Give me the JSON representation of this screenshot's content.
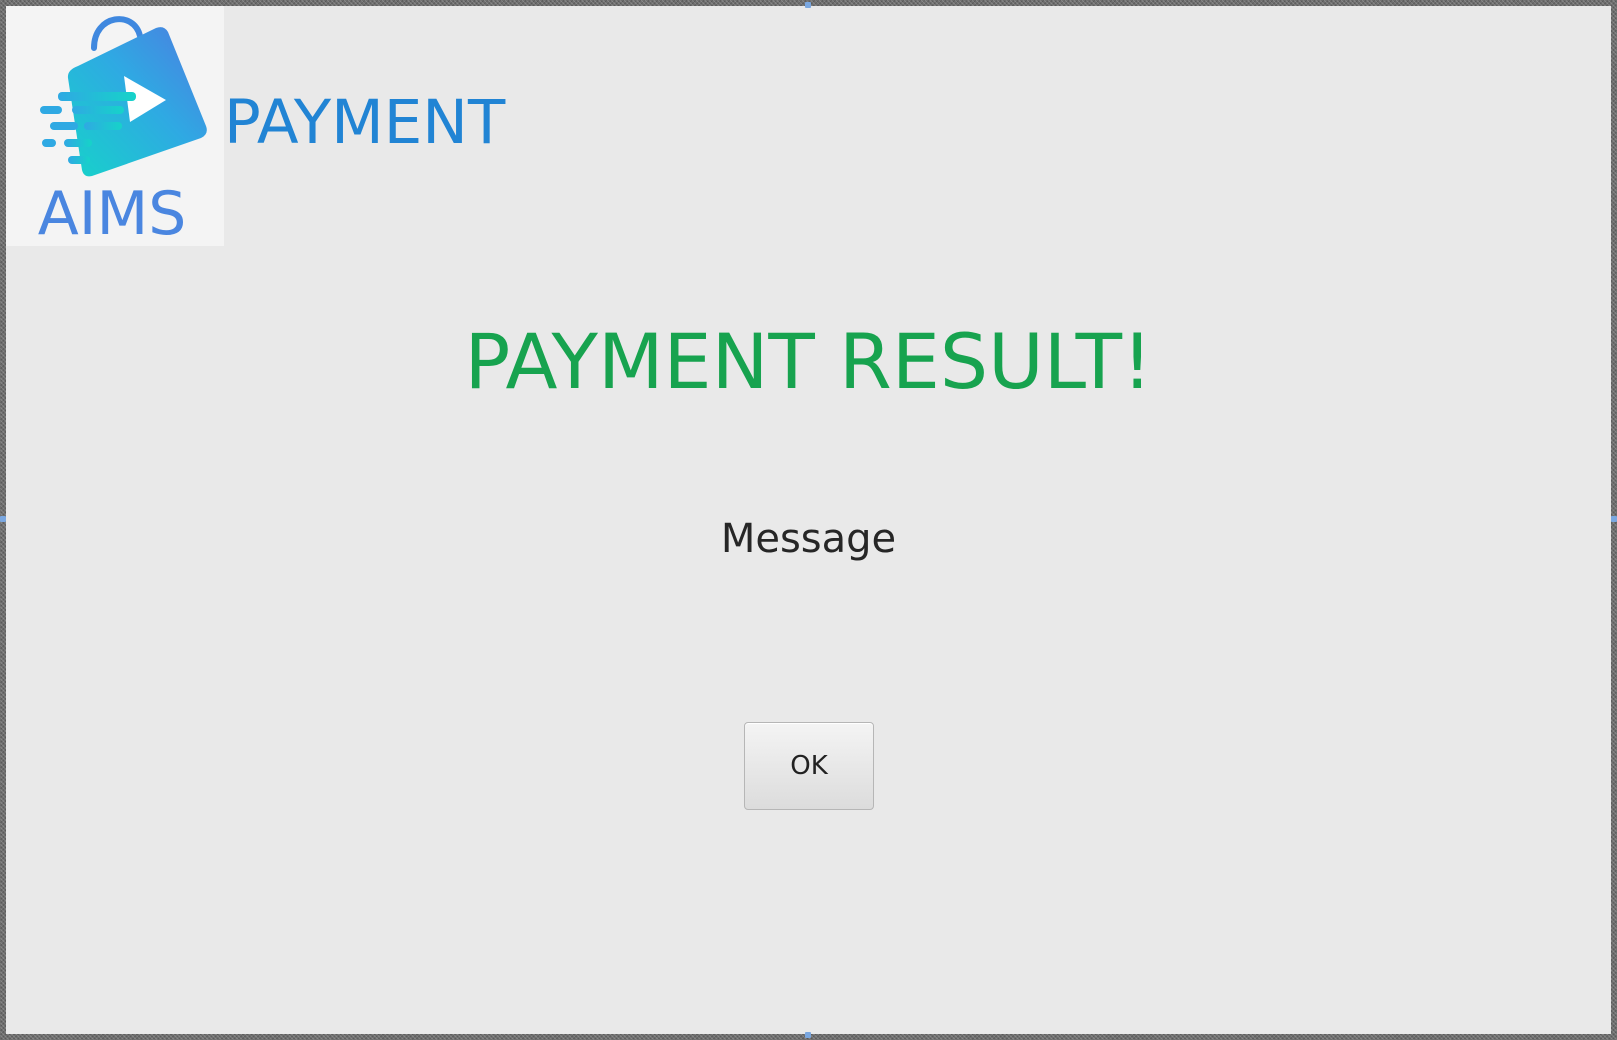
{
  "logo": {
    "text": "AIMS",
    "icon": "shopping-bag-arrow-icon",
    "text_color": "#4a86e0"
  },
  "header": {
    "title": "PAYMENT",
    "color": "#2184d4"
  },
  "result": {
    "title": "PAYMENT RESULT!",
    "color": "#17a34f",
    "message": "Message"
  },
  "actions": {
    "ok_label": "OK"
  }
}
